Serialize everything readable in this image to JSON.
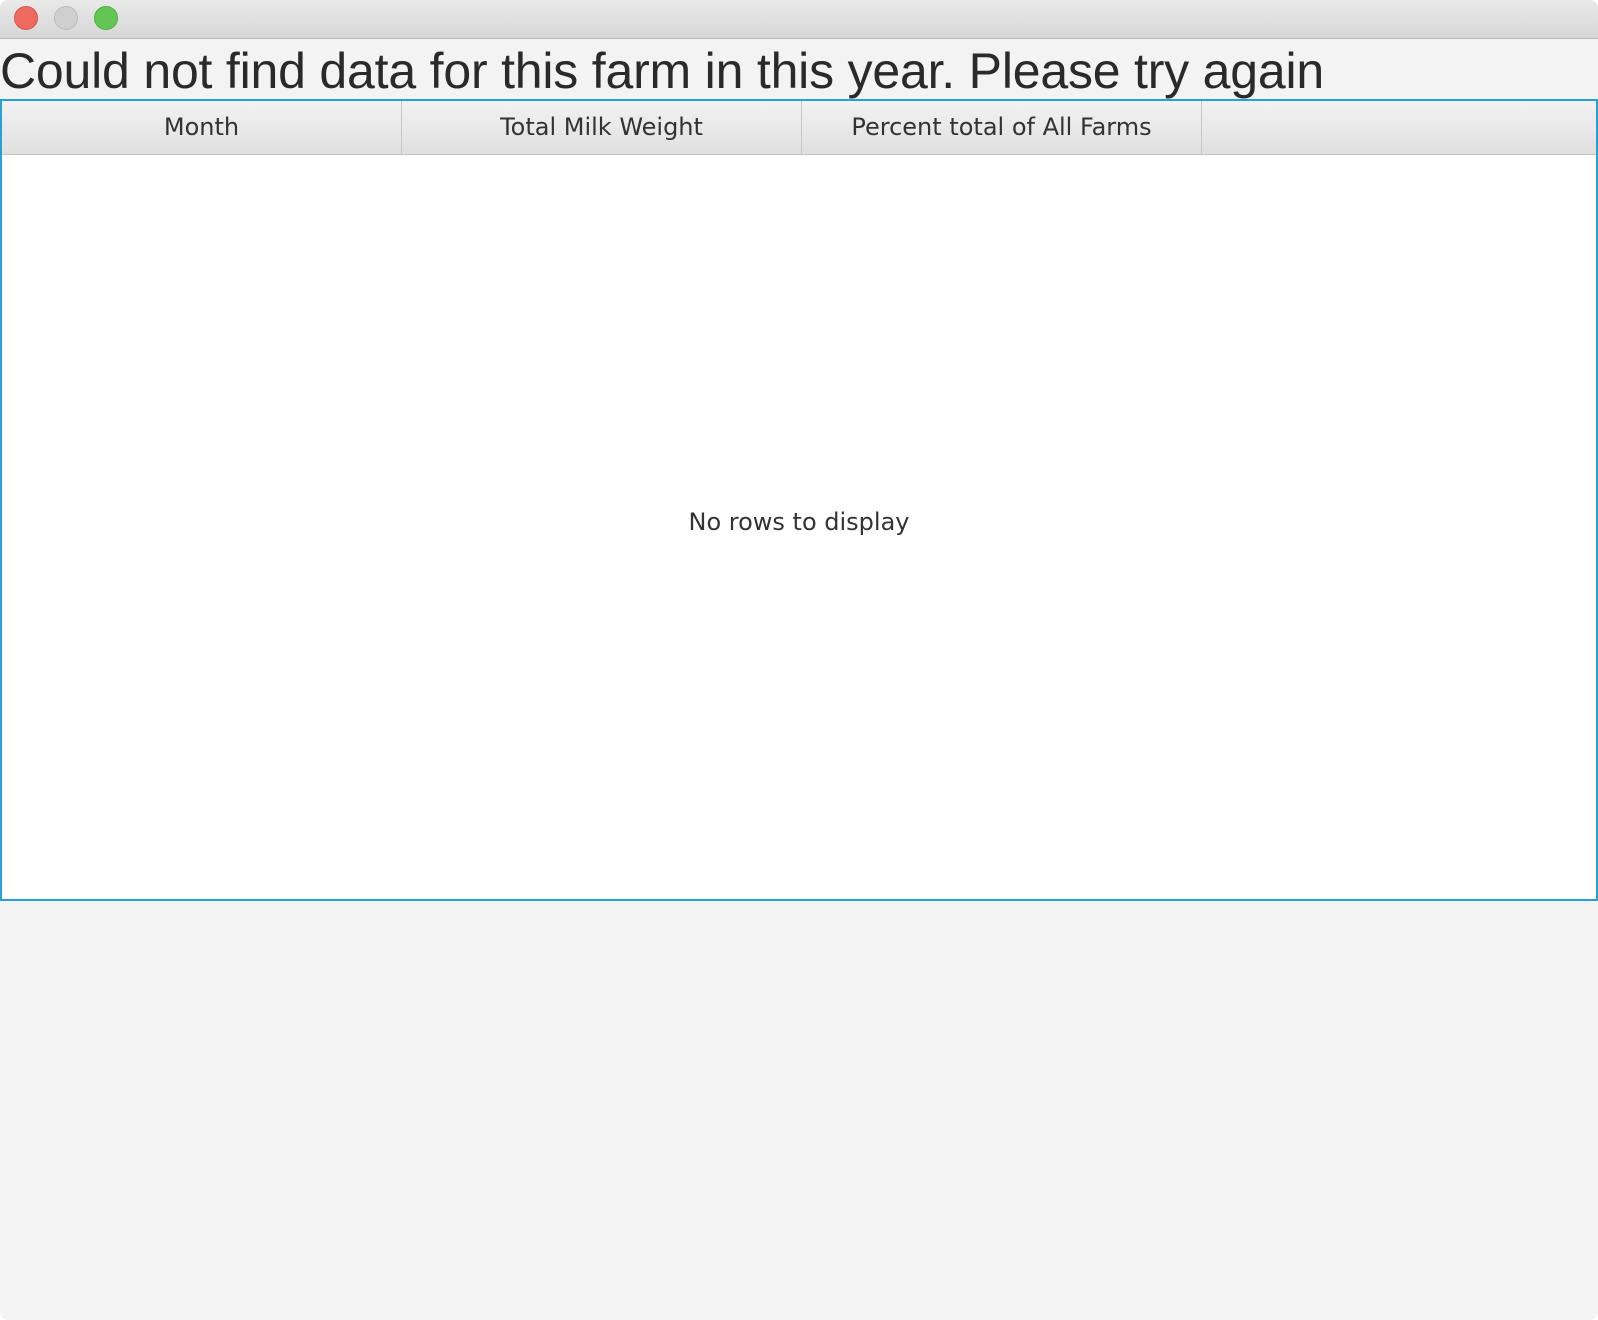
{
  "window": {
    "controls": [
      "close",
      "minimize",
      "zoom"
    ]
  },
  "message": "Could not find data for this farm in this year. Please try again",
  "table": {
    "columns": [
      "Month",
      "Total Milk Weight",
      "Percent total of All Farms",
      ""
    ],
    "rows": [],
    "empty_text": "No rows to display"
  },
  "colors": {
    "focus_border": "#2a9fd6",
    "close": "#ee6a5f",
    "minimize": "#cfcfcf",
    "zoom": "#62c655"
  }
}
